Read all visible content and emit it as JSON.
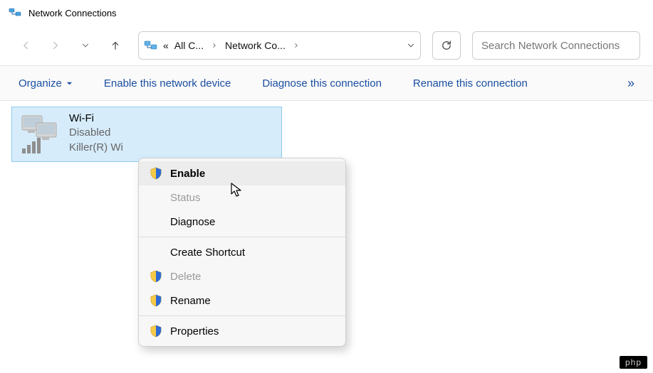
{
  "window": {
    "title": "Network Connections"
  },
  "breadcrumb": {
    "prefix": "«",
    "seg1": "All C...",
    "seg2": "Network Co..."
  },
  "search": {
    "placeholder": "Search Network Connections"
  },
  "toolbar": {
    "organize": "Organize",
    "enable_device": "Enable this network device",
    "diagnose": "Diagnose this connection",
    "rename": "Rename this connection",
    "overflow": "»"
  },
  "adapter": {
    "name": "Wi-Fi",
    "status": "Disabled",
    "hardware": "Killer(R) Wi"
  },
  "context_menu": {
    "enable": "Enable",
    "status": "Status",
    "diagnose": "Diagnose",
    "create_shortcut": "Create Shortcut",
    "delete": "Delete",
    "rename": "Rename",
    "properties": "Properties"
  },
  "watermark": "php"
}
